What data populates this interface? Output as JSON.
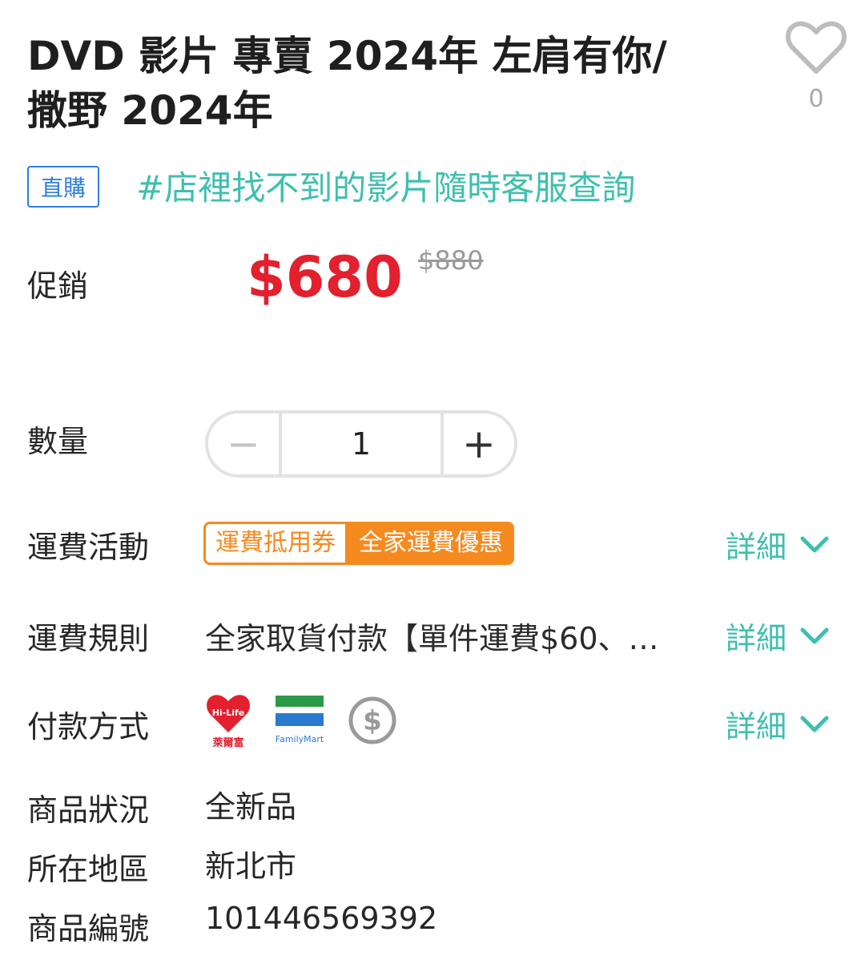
{
  "product": {
    "title_line1": "DVD 影片 專賣 2024年 左肩有你/",
    "title_line2": "撒野 2024年",
    "favorite_count": "0",
    "badge": "直購",
    "hashtag": "#店裡找不到的影片隨時客服查詢"
  },
  "price": {
    "label": "促銷",
    "sale": "$680",
    "original": "$880",
    "sale_color": "#e3202e"
  },
  "quantity": {
    "label": "數量",
    "value": "1",
    "minus": "−",
    "plus": "+"
  },
  "shipping_promo": {
    "label": "運費活動",
    "tags": [
      "運費抵用券",
      "全家運費優惠"
    ],
    "detail": "詳細"
  },
  "shipping_rule": {
    "label": "運費規則",
    "text": "全家取貨付款【單件運費$60、…",
    "detail": "詳細"
  },
  "payment": {
    "label": "付款方式",
    "methods": [
      {
        "icon": "hilife-icon",
        "text": "Hi-Life",
        "sub": "萊爾富"
      },
      {
        "icon": "familymart-icon",
        "text": "FamilyMart"
      },
      {
        "icon": "cash-dollar-icon"
      }
    ],
    "detail": "詳細"
  },
  "info": [
    {
      "label": "商品狀況",
      "value": "全新品"
    },
    {
      "label": "所在地區",
      "value": "新北市"
    },
    {
      "label": "商品編號",
      "value": "101446569392"
    }
  ],
  "colors": {
    "accent": "#3fbfae",
    "orange": "#f58a1f",
    "blue": "#2f7fe0"
  }
}
